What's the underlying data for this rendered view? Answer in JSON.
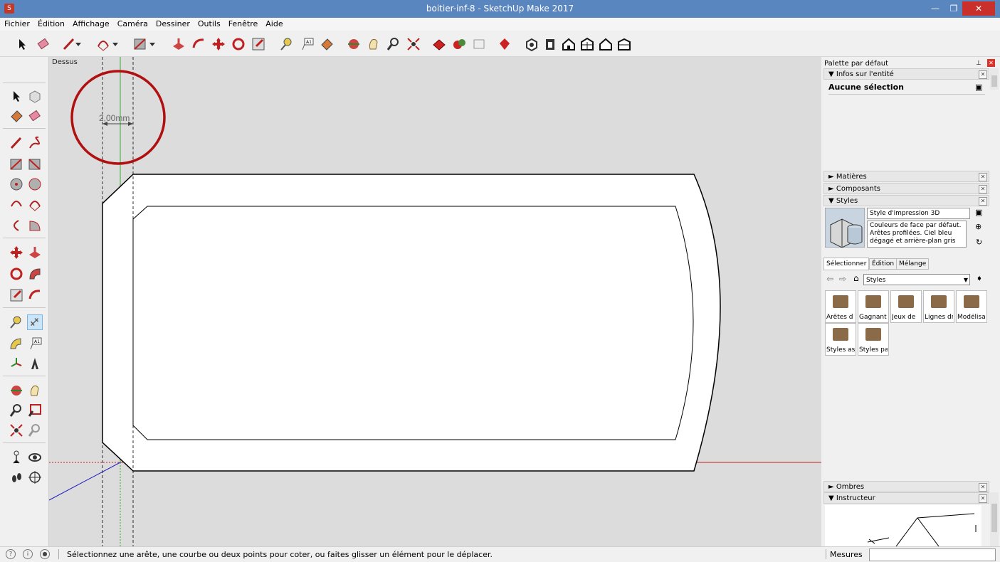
{
  "window": {
    "title": "boitier-inf-8 - SketchUp Make 2017"
  },
  "menu": [
    "Fichier",
    "Édition",
    "Affichage",
    "Caméra",
    "Dessiner",
    "Outils",
    "Fenêtre",
    "Aide"
  ],
  "viewport": {
    "view_label": "Dessus",
    "dimension_text": "2,00mm"
  },
  "panel": {
    "tray_title": "Palette par défaut",
    "entity_info": {
      "header": "▼ Infos sur l'entité",
      "selection": "Aucune sélection"
    },
    "sections": {
      "materials": "► Matières",
      "components": "► Composants",
      "styles": "▼ Styles",
      "shadows": "► Ombres",
      "instructor": "▼ Instructeur"
    },
    "style": {
      "name": "Style d'impression 3D",
      "description_lines": [
        "Couleurs de face par défaut.",
        "Arêtes profilées. Ciel bleu",
        "dégagé et arrière-plan gris"
      ]
    },
    "tabs": [
      "Sélectionner",
      "Édition",
      "Mélange"
    ],
    "collection_select": "Styles",
    "thumbnails": [
      "Arêtes d",
      "Gagnant",
      "Jeux de",
      "Lignes dr",
      "Modélisat",
      "Styles as",
      "Styles pa"
    ]
  },
  "status": {
    "message": "Sélectionnez une arête, une courbe ou deux points pour coter, ou faites glisser un élément pour le déplacer.",
    "measures_label": "Mesures",
    "measures_value": ""
  }
}
